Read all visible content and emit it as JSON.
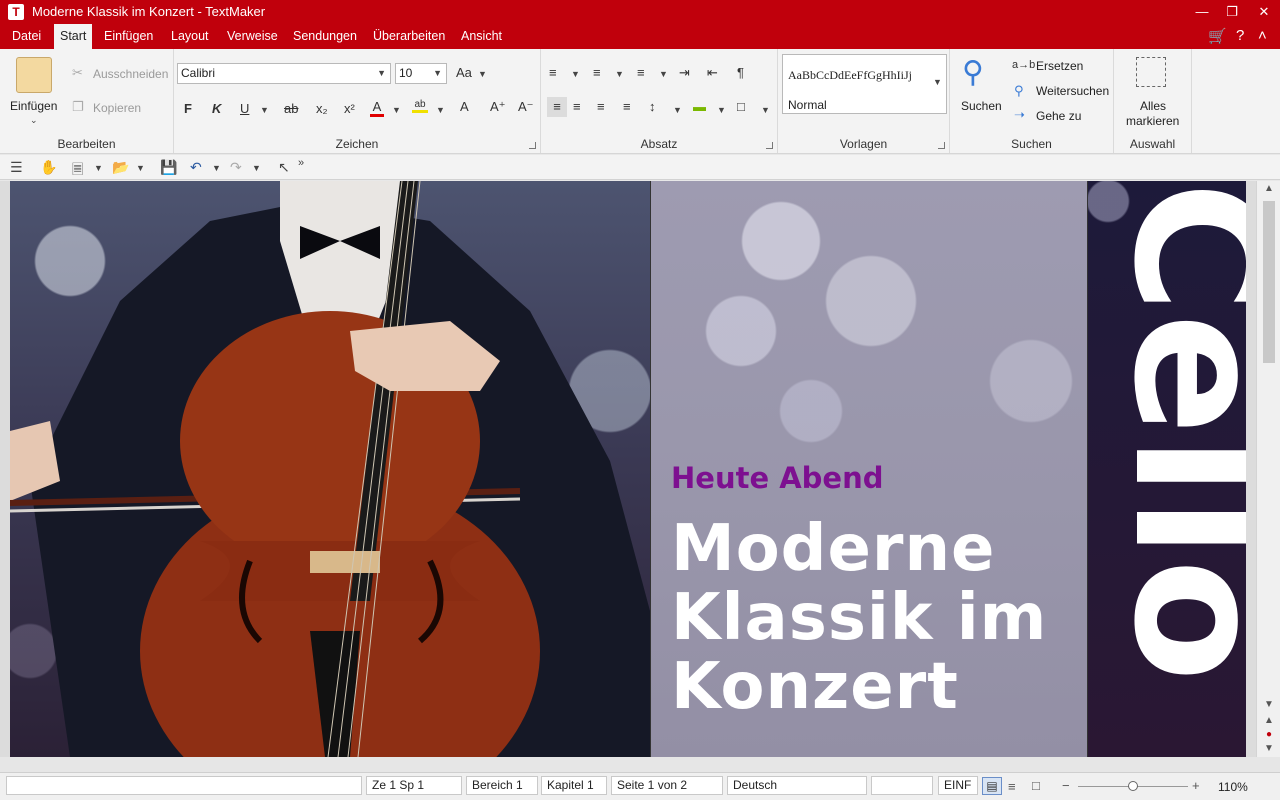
{
  "window": {
    "title": "Moderne Klassik im Konzert - TextMaker"
  },
  "menu": {
    "tabs": [
      "Datei",
      "Start",
      "Einfügen",
      "Layout",
      "Verweise",
      "Sendungen",
      "Überarbeiten",
      "Ansicht"
    ],
    "active": "Start"
  },
  "ribbon": {
    "bearbeiten": {
      "label": "Bearbeiten",
      "paste": "Einfügen",
      "cut": "Ausschneiden",
      "copy": "Kopieren"
    },
    "zeichen": {
      "label": "Zeichen",
      "font": "Calibri",
      "size": "10",
      "bold": "F",
      "italic": "K",
      "underline": "U"
    },
    "absatz": {
      "label": "Absatz"
    },
    "vorlagen": {
      "label": "Vorlagen",
      "preview": "AaBbCcDdEeFfGgHhIiJj",
      "style": "Normal"
    },
    "suchen": {
      "label": "Suchen",
      "search": "Suchen",
      "replace": "Ersetzen",
      "find_next": "Weitersuchen",
      "goto": "Gehe zu"
    },
    "auswahl": {
      "label": "Auswahl",
      "select_all_1": "Alles",
      "select_all_2": "markieren"
    }
  },
  "document": {
    "kicker": "Heute Abend",
    "headline_1": "Moderne",
    "headline_2": "Klassik im",
    "headline_3": "Konzert",
    "vertical_word": "Cello"
  },
  "statusbar": {
    "position": "Ze 1 Sp 1",
    "section": "Bereich 1",
    "chapter": "Kapitel 1",
    "page": "Seite 1 von 2",
    "language": "Deutsch",
    "mode": "EINF",
    "zoom": "110%"
  },
  "colors": {
    "accent": "#c0000c",
    "kicker": "#7d1090"
  }
}
